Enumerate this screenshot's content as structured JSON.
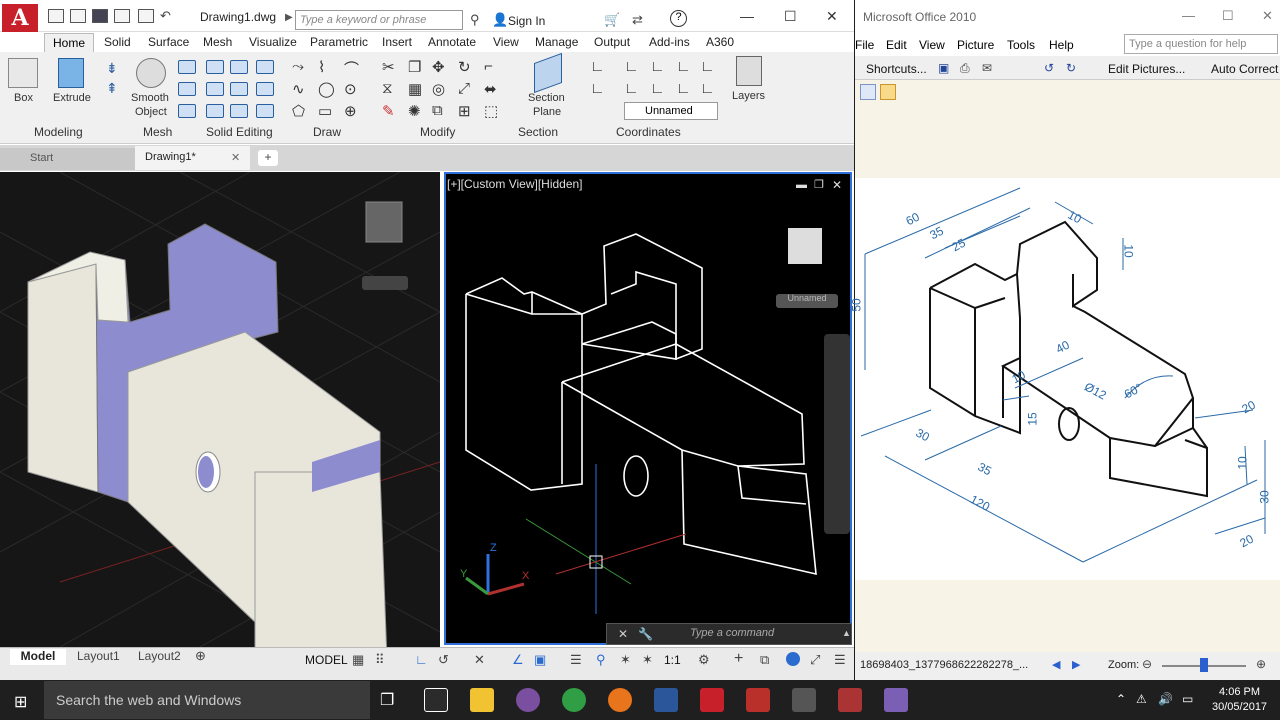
{
  "acad": {
    "doc_title": "Drawing1.dwg",
    "search_placeholder": "Type a keyword or phrase",
    "sign_in": "Sign In",
    "tabs": [
      "Home",
      "Solid",
      "Surface",
      "Mesh",
      "Visualize",
      "Parametric",
      "Insert",
      "Annotate",
      "View",
      "Manage",
      "Output",
      "Add-ins",
      "A360"
    ],
    "big_buttons": {
      "box": "Box",
      "extrude": "Extrude",
      "smooth": "Smooth",
      "object": "Object",
      "section": "Section",
      "plane": "Plane",
      "layers": "Layers"
    },
    "panels": {
      "modeling": "Modeling",
      "mesh": "Mesh",
      "solid_editing": "Solid Editing",
      "draw": "Draw",
      "modify": "Modify",
      "section": "Section",
      "coordinates": "Coordinates"
    },
    "ucs_named": "Unnamed",
    "file_tabs": {
      "start": "Start",
      "drawing": "Drawing1*"
    },
    "viewport_label": "[+][Custom View][Hidden]",
    "viewcube_named": "Unnamed",
    "command_placeholder": "Type a command",
    "layout_tabs": {
      "model": "Model",
      "layout1": "Layout1",
      "layout2": "Layout2"
    },
    "status": {
      "model": "MODEL",
      "scale": "1:1"
    }
  },
  "office": {
    "title": "Microsoft Office 2010",
    "menus": [
      "File",
      "Edit",
      "View",
      "Picture",
      "Tools",
      "Help"
    ],
    "ask": "Type a question for help",
    "toolbar": {
      "shortcuts": "Shortcuts...",
      "edit_pictures": "Edit Pictures...",
      "auto_correct": "Auto Correct"
    },
    "filename": "18698403_1377968622282278_...",
    "zoom": "Zoom:",
    "dims": {
      "d60": "60",
      "d35a": "35",
      "d25": "25",
      "d10a": "10",
      "d10b": "10",
      "d50": "50",
      "d40": "40",
      "d10c": "10",
      "d12": "Ø12",
      "d60deg": "60°",
      "d15": "15",
      "d30a": "30",
      "d35b": "35",
      "d120": "120",
      "d20a": "20",
      "d10d": "10",
      "d30b": "30",
      "d20b": "20"
    }
  },
  "taskbar": {
    "search": "Search the web and Windows",
    "time": "4:06 PM",
    "date": "30/05/2017"
  }
}
